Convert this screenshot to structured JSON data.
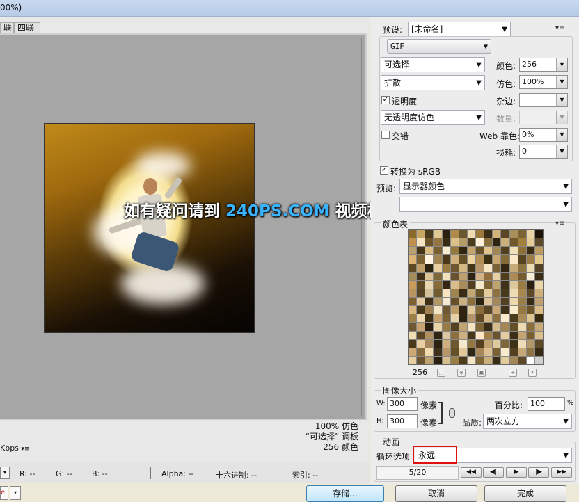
{
  "window": {
    "title_fragment": "00%)"
  },
  "tabs": [
    "联",
    "四联"
  ],
  "watermark": {
    "part1": "如有疑问请到 ",
    "highlight": "240PS.COM",
    "part2": " 视频栏目观看视频教程"
  },
  "preview_info": {
    "line1": "100% 仿色",
    "line2": "“可选择” 调板",
    "line3": "256 颜色"
  },
  "speed_label": "Kbps",
  "status": {
    "r": "R: --",
    "g": "G: --",
    "b": "B: --",
    "alpha": "Alpha: --",
    "hex": "十六进制: --",
    "index": "索引: --"
  },
  "buttons": {
    "save": "存储...",
    "cancel": "取消",
    "done": "完成"
  },
  "settings": {
    "preset_label": "预设:",
    "preset_value": "[未命名]",
    "format_value": "GIF",
    "palette_value": "可选择",
    "dither_algo_value": "扩散",
    "colors_label": "颜色:",
    "colors_value": "256",
    "dither_label": "仿色:",
    "dither_value": "100%",
    "transparency_label": "透明度",
    "matte_label": "杂边:",
    "trans_dither_value": "无透明度仿色",
    "amount_label": "数量:",
    "interlaced_label": "交错",
    "web_snap_label": "Web 靠色:",
    "web_snap_value": "0%",
    "lossy_label": "损耗:",
    "lossy_value": "0",
    "convert_srgb_label": "转换为 sRGB",
    "preview_label": "预览:",
    "preview_value": "显示器颜色",
    "metadata_value": ""
  },
  "color_table": {
    "title": "颜色表",
    "count": "256",
    "colors": [
      "#8a6a2c",
      "#c8a666",
      "#4a3a1c",
      "#e0c894",
      "#2a2010",
      "#b08a48",
      "#6a5630",
      "#f0dcb0",
      "#9a7a3c",
      "#3c2e16",
      "#d4b478",
      "#5a4624",
      "#a8905c",
      "#7c6434",
      "#e8d4a4",
      "#1c140a",
      "#c09050",
      "#f4e4c0",
      "#6c5428",
      "#947440",
      "#382c14",
      "#dcc08a",
      "#b49c68",
      "#4c3c1e",
      "#fcf0d8",
      "#88703c",
      "#2e2410",
      "#ccb07a",
      "#70582c",
      "#a0803c",
      "#e4cc98",
      "#5c4a28",
      "#b8a070",
      "#443418",
      "#d8bc84",
      "#7a6030",
      "#f8ecd0",
      "#94783c",
      "#30240e",
      "#c4a46c",
      "#685028",
      "#e0c490",
      "#a48850",
      "#50401e",
      "#f0e0b8",
      "#8c7038",
      "#3a2c12",
      "#bc9c60",
      "#dcb478",
      "#7c6030",
      "#fff4e0",
      "#a08450",
      "#4c3818",
      "#d0b07c",
      "#645024",
      "#ecd4a0",
      "#b49058",
      "#3c3014",
      "#c8a870",
      "#846c38",
      "#fae8c8",
      "#584420",
      "#9c7c44",
      "#e4c88c",
      "#5e4a22",
      "#c0a06a",
      "#2c2210",
      "#e8d0a0",
      "#9a7c40",
      "#6e5630",
      "#d4b884",
      "#483618",
      "#b8986a",
      "#f6e6c4",
      "#7a6234",
      "#322612",
      "#c8ac78",
      "#8e7440",
      "#ecdcb4",
      "#544022",
      "#a48c58",
      "#403018",
      "#dcc494",
      "#80683a",
      "#f2e2bc",
      "#685230",
      "#bca070",
      "#2e2412",
      "#d0b488",
      "#946e3c",
      "#e6d0a4",
      "#4e3e1e",
      "#ac8c54",
      "#745c2e",
      "#f8eed8",
      "#3a2e18",
      "#c89c5c",
      "#604c24",
      "#e8d8b0",
      "#8a6c38",
      "#342814",
      "#d8bc8c",
      "#aa8c58",
      "#503e1e",
      "#f4e8cc",
      "#7e6634",
      "#c0a46e",
      "#40321a",
      "#dcc89c",
      "#987c44",
      "#2a2010",
      "#ead8ac",
      "#b89460",
      "#564424",
      "#d4c09a",
      "#705a30",
      "#fae4c0",
      "#9e8450",
      "#3a2c14",
      "#c4a872",
      "#6a542a",
      "#e2cc9c",
      "#8e7240",
      "#483a1c",
      "#f0dcb4",
      "#a88850",
      "#5c4826",
      "#cfb07c",
      "#7e6032",
      "#e4caa0",
      "#403016",
      "#b49864",
      "#f6ead0",
      "#66502a",
      "#cab080",
      "#8c6e3a",
      "#2c2210",
      "#dcc498",
      "#a4885a",
      "#524020",
      "#ecd8ac",
      "#9a7e48",
      "#362a14",
      "#c0a070",
      "#d8b880",
      "#4a3a1c",
      "#a08050",
      "#f2e4c4",
      "#705832",
      "#bc9c68",
      "#302410",
      "#e0c898",
      "#886c3a",
      "#5a4624",
      "#cca878",
      "#403218",
      "#f8eccc",
      "#967842",
      "#6c5428",
      "#dcbc88",
      "#9c8048",
      "#eed8b0",
      "#3e3016",
      "#c4a06c",
      "#7a6234",
      "#e6d2a8",
      "#2e2410",
      "#b4946a",
      "#604a26",
      "#d2b684",
      "#8c7040",
      "#fae8cc",
      "#4c3c1c",
      "#a88c5a",
      "#dec490",
      "#38290f",
      "#6e5a32",
      "#caa472",
      "#2a1e0e",
      "#e8d4a8",
      "#987a44",
      "#524222",
      "#c0a474",
      "#f4e2c0",
      "#7e6636",
      "#3a2e16",
      "#d6bc8a",
      "#a48656",
      "#645028",
      "#ecdab0",
      "#8a6e3c",
      "#c8aa7a",
      "#f2dcb4",
      "#5a4422",
      "#b09060",
      "#302410",
      "#dcc8a0",
      "#8c7042",
      "#ceb080",
      "#46361a",
      "#fce8c8",
      "#9e8048",
      "#6a5430",
      "#e4ccA0",
      "#3c2e14",
      "#c4a472",
      "#7a5e30",
      "#dabe8e",
      "#4a3a1a",
      "#e8ceA0",
      "#a6865a",
      "#2c2210",
      "#d0b07e",
      "#6e5830",
      "#f6e8cc",
      "#947842",
      "#563f1e",
      "#c2a470",
      "#deca9c",
      "#80663a",
      "#3c3016",
      "#eedcb8",
      "#b29868",
      "#5e4a26",
      "#cfa878",
      "#8a6c3c",
      "#f0dcb0",
      "#40321a",
      "#b8986a",
      "#665028",
      "#e2c89a",
      "#302614",
      "#a6885a",
      "#dcc094",
      "#7a6032",
      "#f8eace",
      "#524020",
      "#c6a876",
      "#8e7444",
      "#362a14",
      "#e6d0a4",
      "#6a5430",
      "#bea270",
      "#2a2010",
      "#d8be8e",
      "#9a7e48",
      "#4c3c1c",
      "#f2e4c4",
      "#7e6636",
      "#caae7c",
      "#3a2c14",
      "#e2cc9c",
      "#a28656",
      "#5c4826",
      "#fcfcfc",
      "#d0d0d0"
    ]
  },
  "image_size": {
    "title": "图像大小",
    "w_label": "W:",
    "w_value": "300",
    "h_label": "H:",
    "h_value": "300",
    "unit": "像素",
    "percent_label": "百分比:",
    "percent_value": "100",
    "percent_unit": "%",
    "quality_label": "品质:",
    "quality_value": "两次立方"
  },
  "animation": {
    "title": "动画",
    "loop_label": "循环选项",
    "loop_value": "永远",
    "frame_counter": "5/20"
  }
}
